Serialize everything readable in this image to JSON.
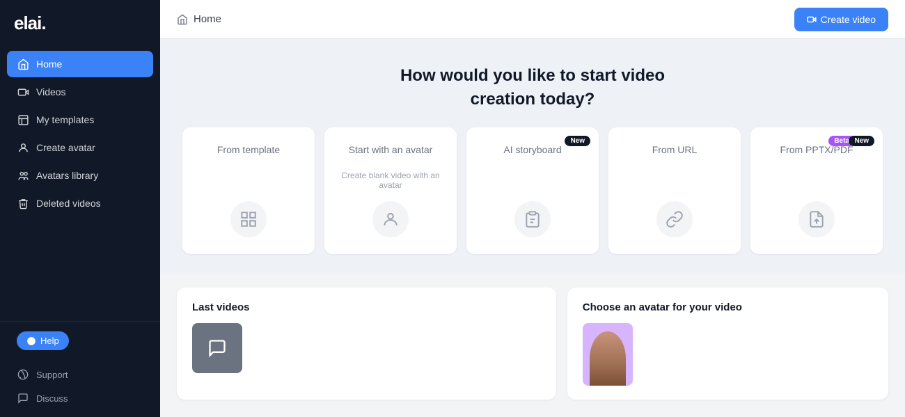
{
  "sidebar": {
    "logo": "elai.",
    "nav_items": [
      {
        "id": "home",
        "label": "Home",
        "active": true,
        "icon": "home"
      },
      {
        "id": "videos",
        "label": "Videos",
        "active": false,
        "icon": "video"
      },
      {
        "id": "my-templates",
        "label": "My templates",
        "active": false,
        "icon": "template"
      },
      {
        "id": "create-avatar",
        "label": "Create avatar",
        "active": false,
        "icon": "person"
      },
      {
        "id": "avatars-library",
        "label": "Avatars library",
        "active": false,
        "icon": "library"
      },
      {
        "id": "deleted-videos",
        "label": "Deleted videos",
        "active": false,
        "icon": "trash"
      }
    ],
    "help_label": "Help",
    "support_label": "Support",
    "discuss_label": "Discuss"
  },
  "topbar": {
    "home_label": "Home",
    "create_video_label": "Create video"
  },
  "hero": {
    "heading": "How would you like to start video",
    "heading2": "creation today?"
  },
  "cards": [
    {
      "id": "from-template",
      "title": "From template",
      "subtitle": "",
      "badge": null,
      "icon": "grid"
    },
    {
      "id": "start-with-avatar",
      "title": "Start with an avatar",
      "subtitle": "Create blank video with an avatar",
      "badge": null,
      "icon": "person-circle"
    },
    {
      "id": "ai-storyboard",
      "title": "AI storyboard",
      "subtitle": "",
      "badge": "New",
      "badge_type": "new",
      "icon": "clipboard"
    },
    {
      "id": "from-url",
      "title": "From URL",
      "subtitle": "",
      "badge": null,
      "icon": "link"
    },
    {
      "id": "from-pptx",
      "title": "From PPTX/PDF",
      "subtitle": "",
      "badge_beta": "Beta",
      "badge_new": "New",
      "icon": "upload-file"
    }
  ],
  "bottom": {
    "last_videos_title": "Last videos",
    "choose_avatar_title": "Choose an avatar for your video"
  }
}
